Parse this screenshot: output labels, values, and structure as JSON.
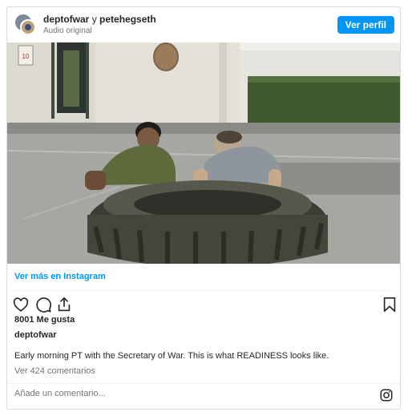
{
  "header": {
    "user1": "deptofwar",
    "conjunction": "y",
    "user2": "petehegseth",
    "audio": "Audio original",
    "profile_button": "Ver perfil"
  },
  "post": {
    "more_link": "Ver más en Instagram",
    "likes": "8001 Me gusta",
    "author": "deptofwar",
    "caption": "Early morning PT with the Secretary of War. This is what READINESS looks like.",
    "view_comments": "Ver 424 comentarios",
    "comment_placeholder": "Añade un comentario..."
  },
  "photo": {
    "sign_text": "10"
  },
  "icons": {
    "like": "heart-icon",
    "comment": "comment-icon",
    "share": "share-icon",
    "save": "bookmark-icon",
    "instagram": "instagram-icon"
  },
  "colors": {
    "accent": "#0095f6",
    "border": "#dbdbdb",
    "muted": "#737373"
  }
}
